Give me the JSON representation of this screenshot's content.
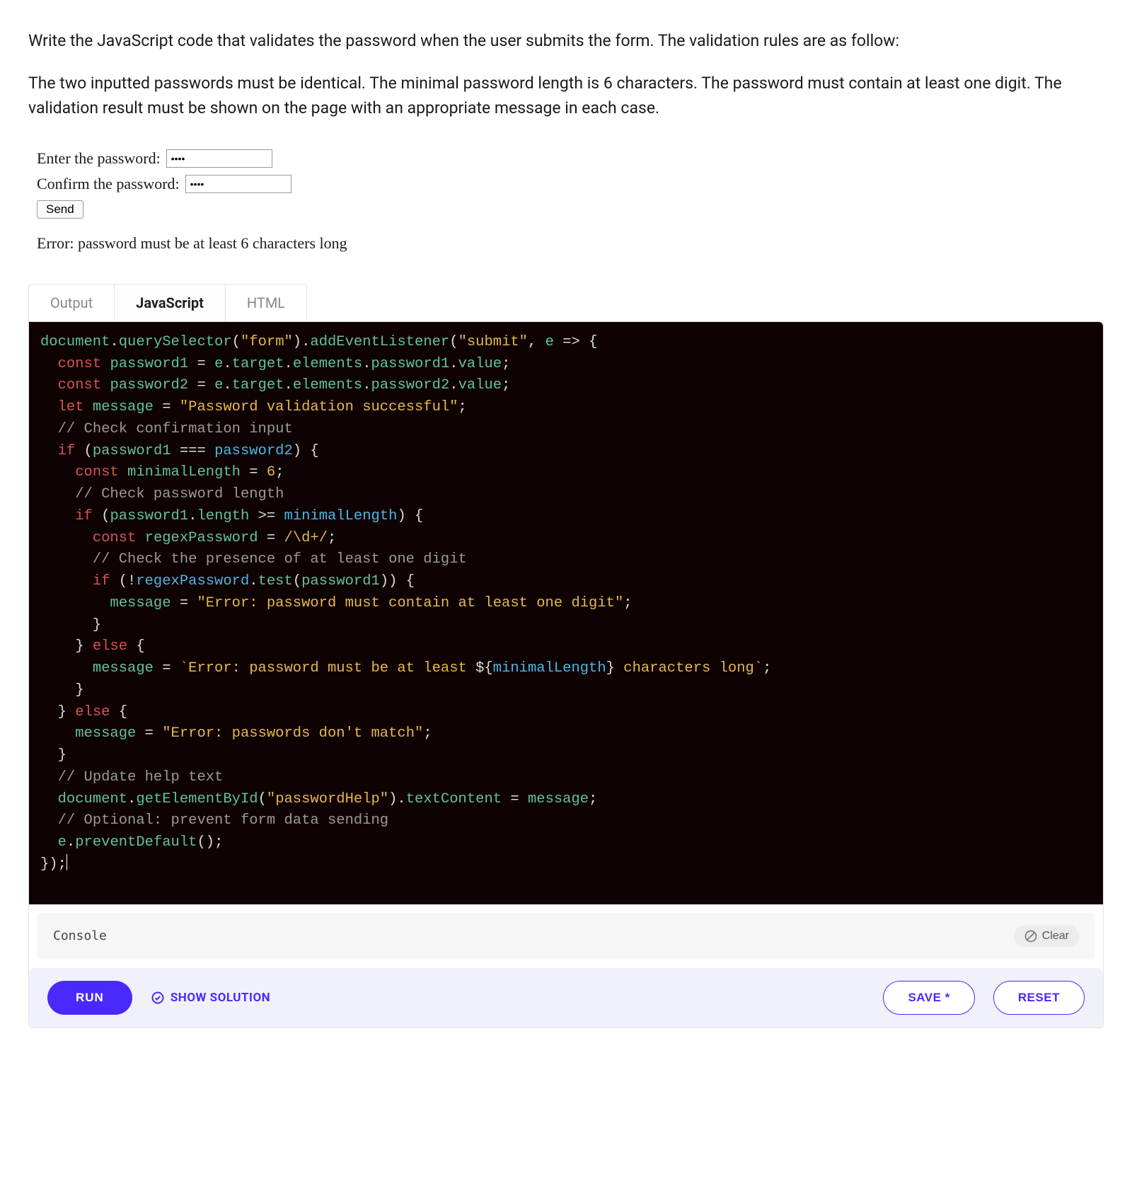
{
  "intro": {
    "p1": "Write the JavaScript code that validates the password when the user submits the form. The validation rules are as follow:",
    "p2": "The two inputted passwords must be identical. The minimal password length is 6 characters. The password must contain at least one digit. The validation result must be shown on the page with an appropriate message in each case."
  },
  "preview": {
    "enter_label": "Enter the password:",
    "confirm_label": "Confirm the password:",
    "mask1": "••••",
    "mask2": "••••",
    "send_label": "Send",
    "help_text": "Error: password must be at least 6 characters long"
  },
  "tabs": {
    "output": "Output",
    "javascript": "JavaScript",
    "html": "HTML"
  },
  "console": {
    "title": "Console",
    "clear": "Clear"
  },
  "actions": {
    "run": "RUN",
    "show_solution": "SHOW SOLUTION",
    "save": "SAVE *",
    "reset": "RESET"
  },
  "code": {
    "l1_form": "\"form\"",
    "l1_submit": "\"submit\"",
    "l4_msg": "\"Password validation successful\"",
    "l5_cmt": "// Check confirmation input",
    "l7_num": "6",
    "l8_cmt": "// Check password length",
    "l10_regex": "/\\d+/",
    "l11_cmt": "// Check the presence of at least one digit",
    "l13_msg": "\"Error: password must contain at least one digit\"",
    "l16_tpl_a": "`Error: password must be at least ",
    "l16_tpl_b": " characters long`",
    "l19_msg": "\"Error: passwords don't match\"",
    "l21_cmt": "// Update help text",
    "l22_id": "\"passwordHelp\"",
    "l23_cmt": "// Optional: prevent form data sending"
  }
}
